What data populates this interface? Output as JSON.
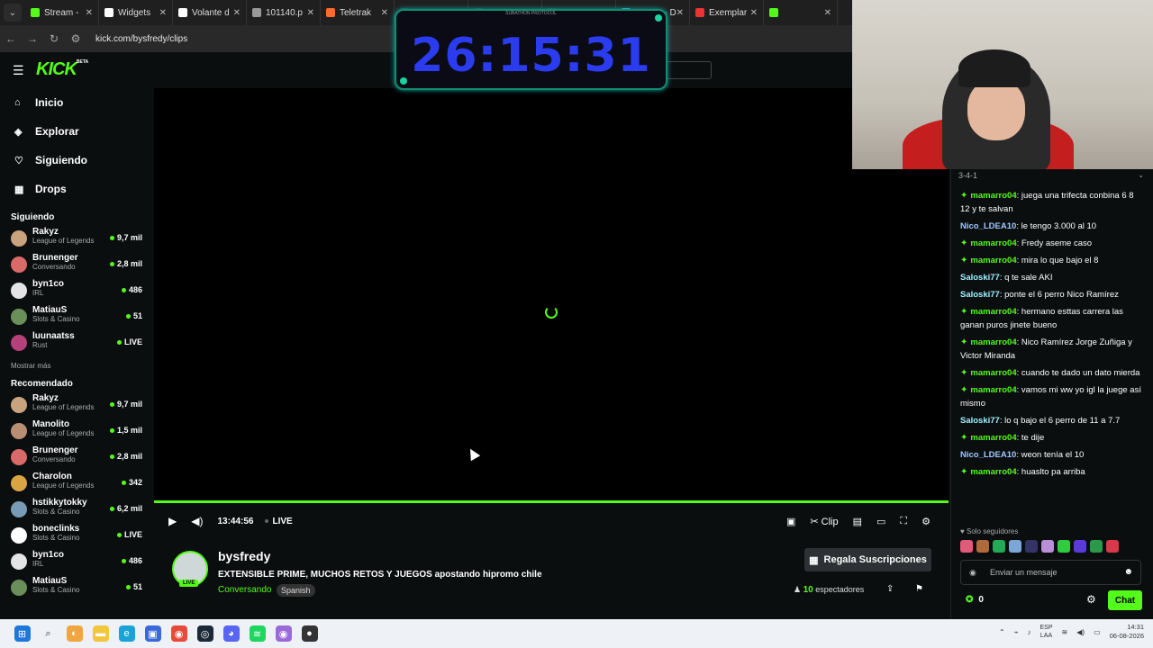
{
  "browser": {
    "tabs": [
      {
        "label": "Stream -",
        "color": "#53fc18"
      },
      {
        "label": "Widgets",
        "color": "#ffffff"
      },
      {
        "label": "Volante d",
        "color": "#ffffff"
      },
      {
        "label": "101140.p",
        "color": "#999999"
      },
      {
        "label": "Teletrak",
        "color": "#ff6a2c"
      },
      {
        "label": "",
        "color": "#333333"
      },
      {
        "label": "",
        "color": "#333333"
      },
      {
        "label": "",
        "color": "#333333"
      },
      {
        "label": "SICOL - D",
        "color": "#3aa3e3"
      },
      {
        "label": "Exemplar",
        "color": "#e33"
      },
      {
        "label": "",
        "color": "#53fc18"
      }
    ],
    "url": "kick.com/bysfredy/clips"
  },
  "logo": "KICK",
  "logo_badge": "BETA",
  "timer": {
    "label": "SUBATHON PROTOCOL",
    "value": "26:15:31"
  },
  "sidebar": {
    "nav": [
      {
        "label": "Inicio",
        "icon": "home-icon",
        "glyph": "⌂"
      },
      {
        "label": "Explorar",
        "icon": "compass-icon",
        "glyph": "◈"
      },
      {
        "label": "Siguiendo",
        "icon": "heart-icon",
        "glyph": "♡"
      },
      {
        "label": "Drops",
        "icon": "drops-icon",
        "glyph": "▦"
      }
    ],
    "following_title": "Siguiendo",
    "following": [
      {
        "name": "Rakyz",
        "category": "League of Legends",
        "viewers": "9,7 mil",
        "color": "#c9a27e"
      },
      {
        "name": "Brunenger",
        "category": "Conversando",
        "viewers": "2,8 mil",
        "color": "#d86a6a"
      },
      {
        "name": "byn1co",
        "category": "IRL",
        "viewers": "486",
        "color": "#e4e4e4"
      },
      {
        "name": "MatiauS",
        "category": "Slots & Casino",
        "viewers": "51",
        "color": "#6a8f5a"
      },
      {
        "name": "luunaatss",
        "category": "Rust",
        "viewers": "LIVE",
        "color": "#b4417a"
      }
    ],
    "show_more": "Mostrar más",
    "recommended_title": "Recomendado",
    "recommended": [
      {
        "name": "Rakyz",
        "category": "League of Legends",
        "viewers": "9,7 mil",
        "color": "#c9a27e"
      },
      {
        "name": "Manolito",
        "category": "League of Legends",
        "viewers": "1,5 mil",
        "color": "#b98f73"
      },
      {
        "name": "Brunenger",
        "category": "Conversando",
        "viewers": "2,8 mil",
        "color": "#d86a6a"
      },
      {
        "name": "Charolon",
        "category": "League of Legends",
        "viewers": "342",
        "color": "#d9a441"
      },
      {
        "name": "hstikkytokky",
        "category": "Slots & Casino",
        "viewers": "6,2 mil",
        "color": "#7a9bb5"
      },
      {
        "name": "boneclinks",
        "category": "Slots & Casino",
        "viewers": "LIVE",
        "color": "#ffffff"
      },
      {
        "name": "byn1co",
        "category": "IRL",
        "viewers": "486",
        "color": "#e4e4e4"
      },
      {
        "name": "MatiauS",
        "category": "Slots & Casino",
        "viewers": "51",
        "color": "#6a8f5a"
      }
    ]
  },
  "player": {
    "time": "13:44:56",
    "live": "LIVE",
    "clip_label": "Clip"
  },
  "stream": {
    "streamer": "bysfredy",
    "live_tag": "LIVE",
    "title": "EXTENSIBLE PRIME, MUCHOS RETOS Y JUEGOS apostando hipromo chile",
    "category": "Conversando",
    "language": "Spanish",
    "subscribe_label": "Regala Suscripciones",
    "viewers_count": "10",
    "viewers_label": "espectadores"
  },
  "chat": {
    "header": "3-4-1",
    "messages": [
      {
        "badge": true,
        "user": "mamarro04",
        "color": "#53fc18",
        "text": "juega una trifecta conbina 6 8 12 y te salvan"
      },
      {
        "badge": false,
        "user": "Nico_LDEA10",
        "color": "#a3c8ff",
        "text": "le tengo 3.000 al 10"
      },
      {
        "badge": true,
        "user": "mamarro04",
        "color": "#53fc18",
        "text": "Fredy aseme caso"
      },
      {
        "badge": true,
        "user": "mamarro04",
        "color": "#53fc18",
        "text": "mira lo que bajo el 8"
      },
      {
        "badge": false,
        "user": "Saloski77",
        "color": "#9ff2ff",
        "text": "q te sale AKI"
      },
      {
        "badge": false,
        "user": "Saloski77",
        "color": "#9ff2ff",
        "text": "ponte el 6 perro Nico Ramírez"
      },
      {
        "badge": true,
        "user": "mamarro04",
        "color": "#53fc18",
        "text": "hermano esttas carrera las ganan puros jinete bueno"
      },
      {
        "badge": true,
        "user": "mamarro04",
        "color": "#53fc18",
        "text": "Nico Ramírez Jorge Zuñiga y Victor Miranda"
      },
      {
        "badge": true,
        "user": "mamarro04",
        "color": "#53fc18",
        "text": "cuando te dado un dato mierda"
      },
      {
        "badge": true,
        "user": "mamarro04",
        "color": "#53fc18",
        "text": "vamos mi ww yo igl la juege así mismo"
      },
      {
        "badge": false,
        "user": "Saloski77",
        "color": "#9ff2ff",
        "text": "lo q bajo el 6 perro de 11 a 7.7"
      },
      {
        "badge": true,
        "user": "mamarro04",
        "color": "#53fc18",
        "text": "te dije"
      },
      {
        "badge": false,
        "user": "Nico_LDEA10",
        "color": "#a3c8ff",
        "text": "weon tenía el 10"
      },
      {
        "badge": true,
        "user": "mamarro04",
        "color": "#53fc18",
        "text": "huaslto pa arriba"
      }
    ],
    "followers_only": "Solo seguidores",
    "emote_colors": [
      "#e05a7a",
      "#b06a3a",
      "#22aa55",
      "#7aa7d8",
      "#333366",
      "#b98fd8",
      "#2ecc40",
      "#5a3ad8",
      "#2a9a4a",
      "#d83a4a"
    ],
    "input_placeholder": "Enviar un mensaje",
    "points": "0",
    "send_label": "Chat"
  },
  "taskbar": {
    "icons": [
      {
        "name": "windows-start-icon",
        "color": "#1e78d8",
        "glyph": "⊞"
      },
      {
        "name": "search-icon",
        "color": "transparent",
        "glyph": "⌕"
      },
      {
        "name": "copilot-icon",
        "color": "#f0a540",
        "glyph": "◐"
      },
      {
        "name": "file-explorer-icon",
        "color": "#f3c640",
        "glyph": "▬"
      },
      {
        "name": "edge-icon",
        "color": "#1aa3d8",
        "glyph": "e"
      },
      {
        "name": "store-icon",
        "color": "#3a6ad8",
        "glyph": "▣"
      },
      {
        "name": "chrome-icon",
        "color": "#e84a3a",
        "glyph": "◉"
      },
      {
        "name": "steam-icon",
        "color": "#1b2838",
        "glyph": "◎"
      },
      {
        "name": "discord-icon",
        "color": "#5865f2",
        "glyph": "◕"
      },
      {
        "name": "spotify-icon",
        "color": "#1ed760",
        "glyph": "≋"
      },
      {
        "name": "chrome-active-icon",
        "color": "#9a6ad8",
        "glyph": "◉"
      },
      {
        "name": "obs-icon",
        "color": "#333333",
        "glyph": "●"
      }
    ],
    "lang_top": "ESP",
    "lang_bottom": "LAA",
    "time": "14:31",
    "date": "06-08-2026"
  }
}
